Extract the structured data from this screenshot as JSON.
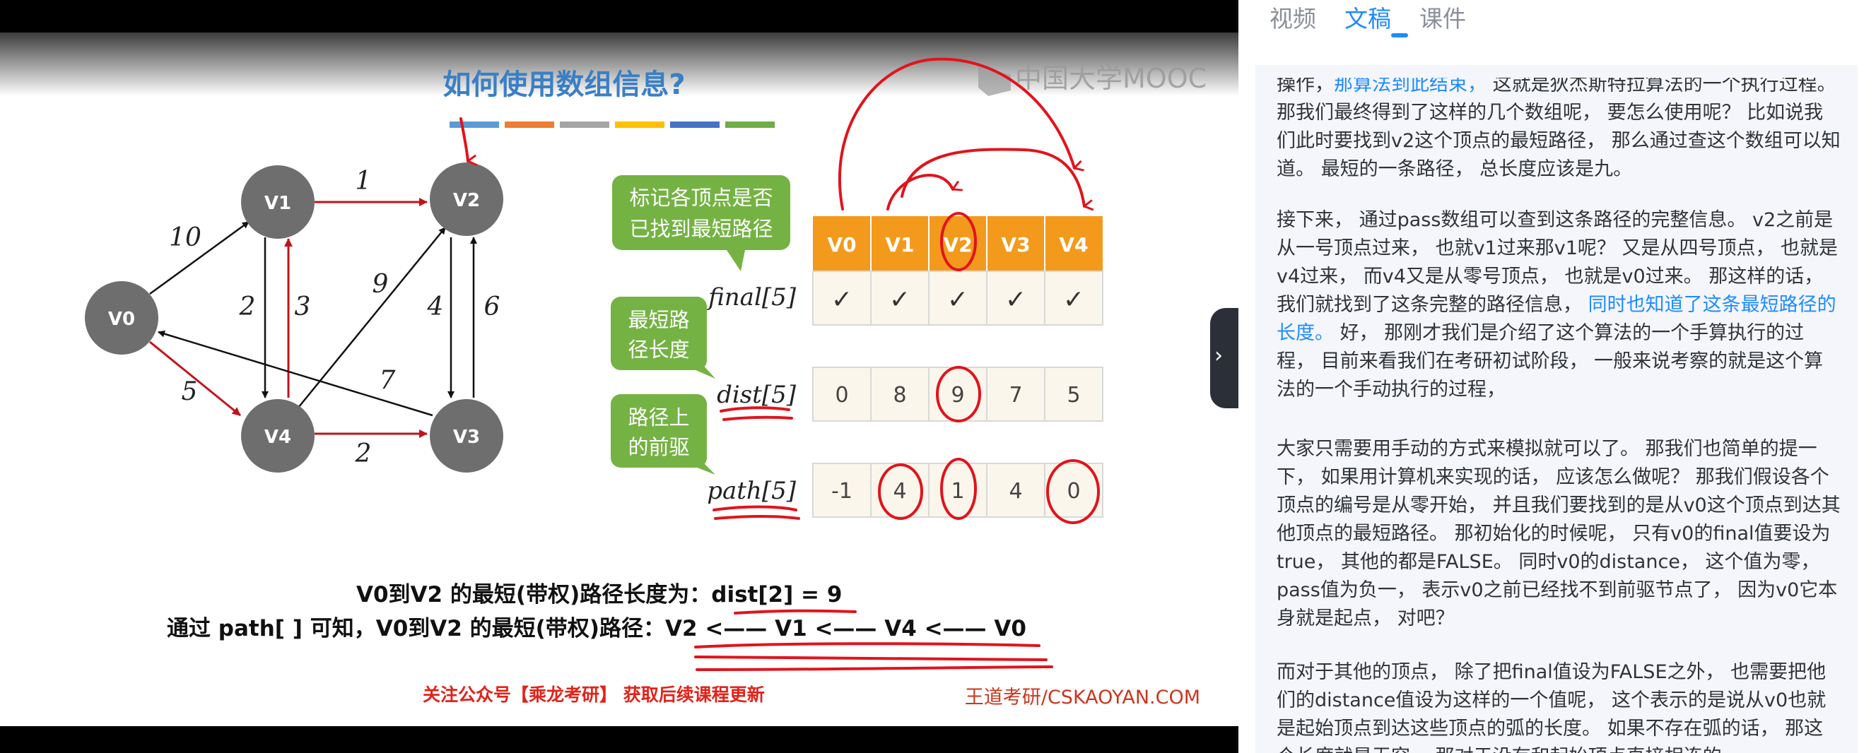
{
  "video": {
    "slide_title": "如何使用数组信息?",
    "watermark": "中国大学MOOC",
    "graph": {
      "nodes": [
        "V0",
        "V1",
        "V2",
        "V3",
        "V4"
      ],
      "edge_weights": [
        "10",
        "1",
        "2",
        "3",
        "9",
        "4",
        "6",
        "5",
        "7",
        "2"
      ]
    },
    "callouts": {
      "final_desc": [
        "标记各顶点是否",
        "已找到最短路径"
      ],
      "dist_desc": [
        "最短路",
        "径长度"
      ],
      "path_desc": [
        "路径上",
        "的前驱"
      ]
    },
    "table": {
      "headers": [
        "V0",
        "V1",
        "V2",
        "V3",
        "V4"
      ],
      "final_label": "final[5]",
      "final_values": [
        "✓",
        "✓",
        "✓",
        "✓",
        "✓"
      ],
      "dist_label": "dist[5]",
      "dist_values": [
        "0",
        "8",
        "9",
        "7",
        "5"
      ],
      "path_label": "path[5]",
      "path_values": [
        "-1",
        "4",
        "1",
        "4",
        "0"
      ]
    },
    "result_line1_prefix": "V0到V2 的最短(带权)路径长度为：",
    "result_line1_value": "dist[2] = 9",
    "result_line2_prefix": "通过 path[ ] 可知，V0到V2 的最短(带权)路径：",
    "result_line2_value": "V2 <—— V1 <—— V4 <—— V0",
    "footer_left": "关注公众号【乘龙考研】 获取后续课程更新",
    "footer_right": "王道考研/CSKAOYAN.COM",
    "collapse_icon": "chevron-right"
  },
  "panel": {
    "tabs": [
      "视频",
      "文稿",
      "课件"
    ],
    "active_tab": "文稿",
    "accent_color": "#1e8bff",
    "paragraphs": [
      [
        {
          "t": "操作，"
        },
        {
          "t": "那算法到此结束，",
          "hl": true
        },
        {
          "t": " 这就是狄杰斯特拉算法的一个执行过程。 那我们最终得到了这样的几个数组呢， 要怎么使用呢？ 比如说我们此时要找到v2这个顶点的最短路径， 那么通过查这个数组可以知道。 最短的一条路径， 总长度应该是九。"
        }
      ],
      [
        {
          "t": "接下来， 通过pass数组可以查到这条路径的完整信息。 v2之前是从一号顶点过来， 也就v1过来那v1呢？ 又是从四号顶点， 也就是v4过来， 而v4又是从零号顶点， 也就是v0过来。 那这样的话， 我们就找到了这条完整的路径信息， "
        },
        {
          "t": "同时也知道了这条最短路径的长度。",
          "hl": true
        },
        {
          "t": " 好， 那刚才我们是介绍了这个算法的一个手算执行的过程， 目前来看我们在考研初试阶段， 一般来说考察的就是这个算法的一个手动执行的过程，"
        }
      ],
      [
        {
          "t": "大家只需要用手动的方式来模拟就可以了。 那我们也简单的提一下， 如果用计算机来实现的话， 应该怎么做呢？ 那我们假设各个顶点的编号是从零开始， 并且我们要找到的是从v0这个顶点到达其他顶点的最短路径。 那初始化的时候呢， 只有v0的final值要设为true， 其他的都是FALSE。 同时v0的distance， 这个值为零， pass值为负一， 表示v0之前已经找不到前驱节点了， 因为v0它本身就是起点， 对吧？"
        }
      ],
      [
        {
          "t": "而对于其他的顶点， 除了把final值设为FALSE之外， 也需要把他们的distance值设为这样的一个值呢， 这个表示的是说从v0也就是起始顶点到达这些顶点的弧的长度。 如果不存在弧的话， 那这个长度就是无穷， 那对于没有和起始顶点直接相连的"
        }
      ]
    ]
  }
}
